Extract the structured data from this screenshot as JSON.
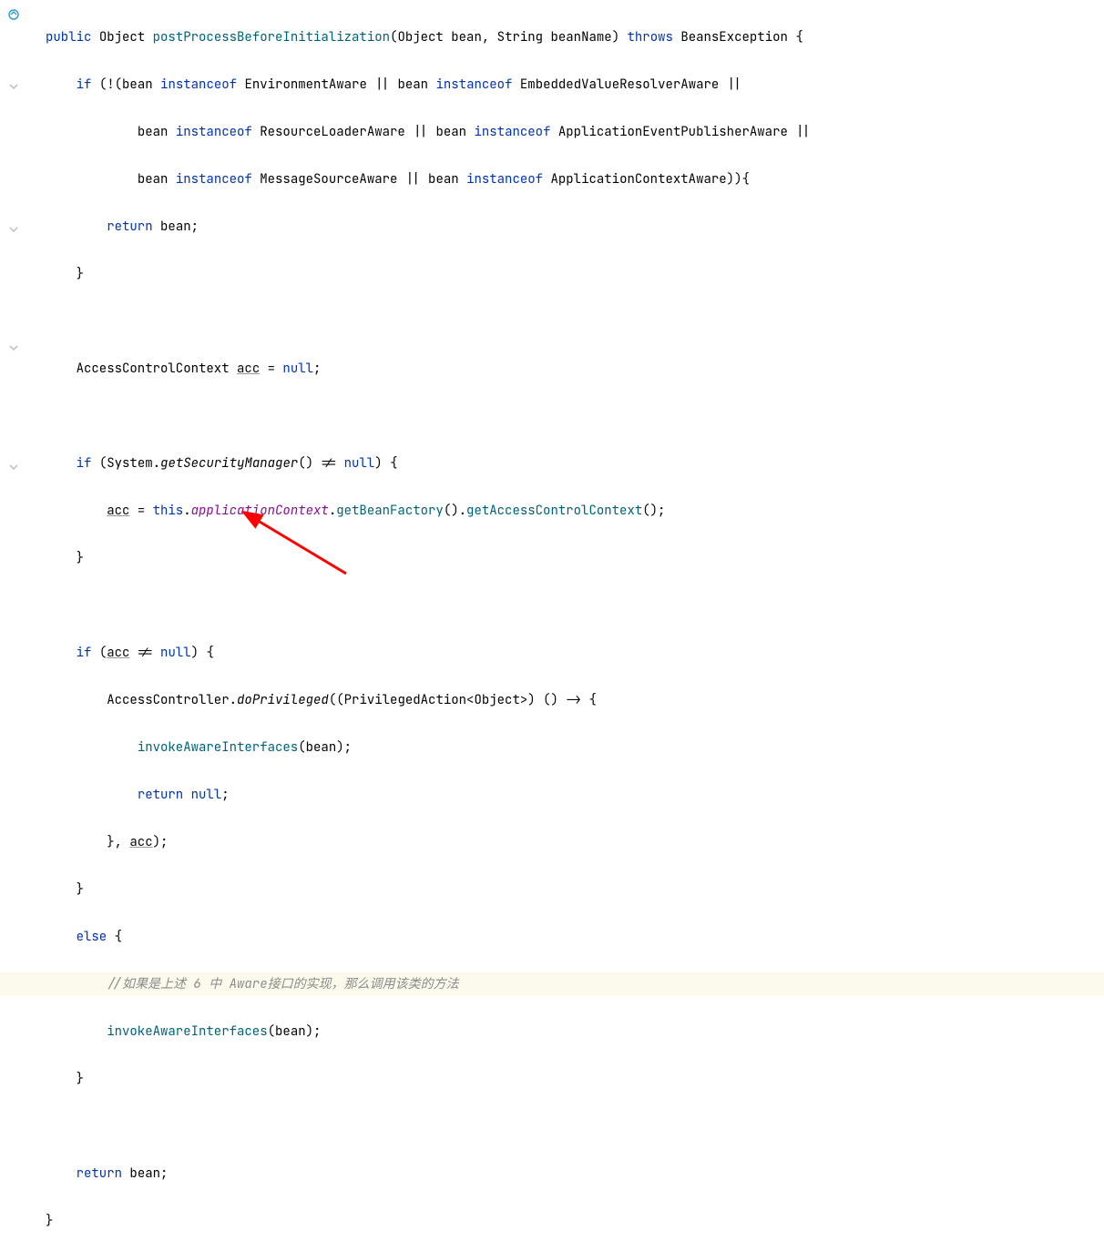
{
  "code": {
    "l1": {
      "kw_public": "public",
      "type_obj": "Object",
      "method": "postProcessBeforeInitialization",
      "p1t": "Object",
      "p1n": "bean",
      "p2t": "String",
      "p2n": "beanName",
      "kw_throws": "throws",
      "exc": "BeansException"
    },
    "l2": {
      "kw_if": "if",
      "p_bean": "bean",
      "kw_io": "instanceof",
      "c1": "EnvironmentAware",
      "c2": "EmbeddedValueResolverAware"
    },
    "l3": {
      "p_bean": "bean",
      "kw_io": "instanceof",
      "c1": "ResourceLoaderAware",
      "c2": "ApplicationEventPublisherAware"
    },
    "l4": {
      "p_bean": "bean",
      "kw_io": "instanceof",
      "c1": "MessageSourceAware",
      "c2": "ApplicationContextAware"
    },
    "l5": {
      "kw_return": "return",
      "p_bean": "bean"
    },
    "l8": {
      "t": "AccessControlContext",
      "v": "acc",
      "kw_null": "null"
    },
    "l10": {
      "kw_if": "if",
      "sys": "System",
      "call": "getSecurityManager",
      "kw_null": "null"
    },
    "l11": {
      "v": "acc",
      "kw_this": "this",
      "fld": "applicationContext",
      "c1": "getBeanFactory",
      "c2": "getAccessControlContext"
    },
    "l14": {
      "kw_if": "if",
      "v": "acc",
      "kw_null": "null"
    },
    "l15": {
      "cls": "AccessController",
      "m": "doPrivileged",
      "cast": "PrivilegedAction",
      "gen": "Object"
    },
    "l16": {
      "m": "invokeAwareInterfaces",
      "p": "bean"
    },
    "l17": {
      "kw_return": "return",
      "kw_null": "null"
    },
    "l18": {
      "v": "acc"
    },
    "l20": {
      "kw_else": "else"
    },
    "l21": {
      "comment": "//如果是上述 6 中 Aware接口的实现，那么调用该类的方法"
    },
    "l22": {
      "m": "invokeAwareInterfaces",
      "p": "bean"
    },
    "l25": {
      "kw_return": "return",
      "p_bean": "bean"
    }
  }
}
